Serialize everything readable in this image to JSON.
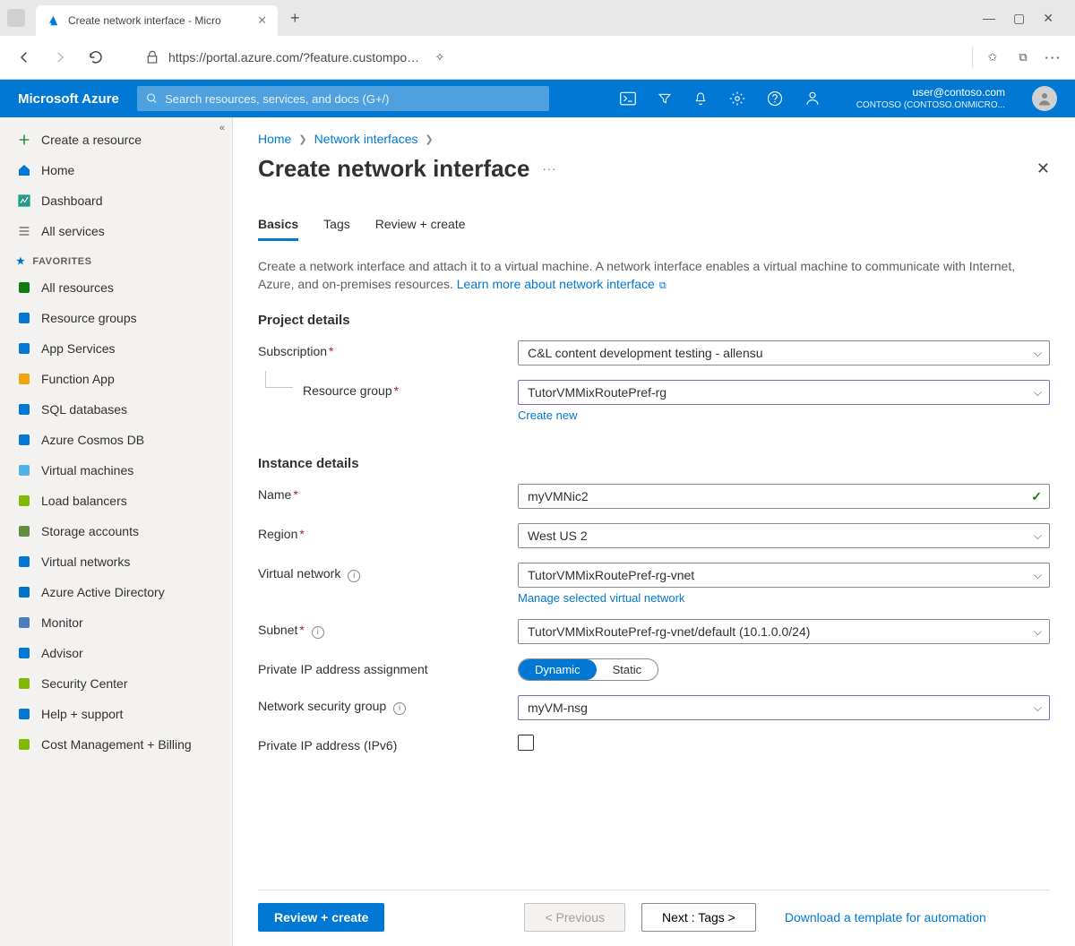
{
  "browser": {
    "tab_title": "Create network interface - Micro",
    "url": "https://portal.azure.com/?feature.customportal=false#creat..."
  },
  "topbar": {
    "brand": "Microsoft Azure",
    "search_placeholder": "Search resources, services, and docs (G+/)",
    "user_email": "user@contoso.com",
    "tenant": "CONTOSO (CONTOSO.ONMICRO..."
  },
  "sidebar": {
    "collapse_hint": "«",
    "items_top": [
      {
        "label": "Create a resource",
        "icon": "plus",
        "color": "#107c10"
      },
      {
        "label": "Home",
        "icon": "home",
        "color": "#0078d4"
      },
      {
        "label": "Dashboard",
        "icon": "dashboard",
        "color": "#1f9e8e"
      },
      {
        "label": "All services",
        "icon": "list",
        "color": "#605e5c"
      }
    ],
    "favorites_label": "FAVORITES",
    "favorites": [
      {
        "label": "All resources",
        "color": "#107c10"
      },
      {
        "label": "Resource groups",
        "color": "#0078d4"
      },
      {
        "label": "App Services",
        "color": "#0078d4"
      },
      {
        "label": "Function App",
        "color": "#f0a30a"
      },
      {
        "label": "SQL databases",
        "color": "#0078d4"
      },
      {
        "label": "Azure Cosmos DB",
        "color": "#0078d4"
      },
      {
        "label": "Virtual machines",
        "color": "#50b2e7"
      },
      {
        "label": "Load balancers",
        "color": "#7fba00"
      },
      {
        "label": "Storage accounts",
        "color": "#5e8f3e"
      },
      {
        "label": "Virtual networks",
        "color": "#0078d4"
      },
      {
        "label": "Azure Active Directory",
        "color": "#0072c6"
      },
      {
        "label": "Monitor",
        "color": "#4d7cbf"
      },
      {
        "label": "Advisor",
        "color": "#0078d4"
      },
      {
        "label": "Security Center",
        "color": "#7fba00"
      },
      {
        "label": "Help + support",
        "color": "#0078d4"
      },
      {
        "label": "Cost Management + Billing",
        "color": "#7fba00"
      }
    ]
  },
  "breadcrumb": {
    "home": "Home",
    "second": "Network interfaces"
  },
  "page": {
    "title": "Create network interface",
    "tabs": [
      "Basics",
      "Tags",
      "Review + create"
    ],
    "intro": "Create a network interface and attach it to a virtual machine. A network interface enables a virtual machine to communicate with Internet, Azure, and on-premises resources.",
    "learn_more": "Learn more about network interface"
  },
  "form": {
    "project_h": "Project details",
    "subscription_label": "Subscription",
    "subscription_value": "C&L content development testing - allensu",
    "rg_label": "Resource group",
    "rg_value": "TutorVMMixRoutePref-rg",
    "rg_create": "Create new",
    "instance_h": "Instance details",
    "name_label": "Name",
    "name_value": "myVMNic2",
    "region_label": "Region",
    "region_value": "West US 2",
    "vnet_label": "Virtual network",
    "vnet_value": "TutorVMMixRoutePref-rg-vnet",
    "vnet_manage": "Manage selected virtual network",
    "subnet_label": "Subnet",
    "subnet_value": "TutorVMMixRoutePref-rg-vnet/default (10.1.0.0/24)",
    "pip_assign_label": "Private IP address assignment",
    "pip_dynamic": "Dynamic",
    "pip_static": "Static",
    "nsg_label": "Network security group",
    "nsg_value": "myVM-nsg",
    "ipv6_label": "Private IP address (IPv6)"
  },
  "footer": {
    "review": "Review + create",
    "prev": "< Previous",
    "next": "Next : Tags >",
    "download": "Download a template for automation"
  }
}
